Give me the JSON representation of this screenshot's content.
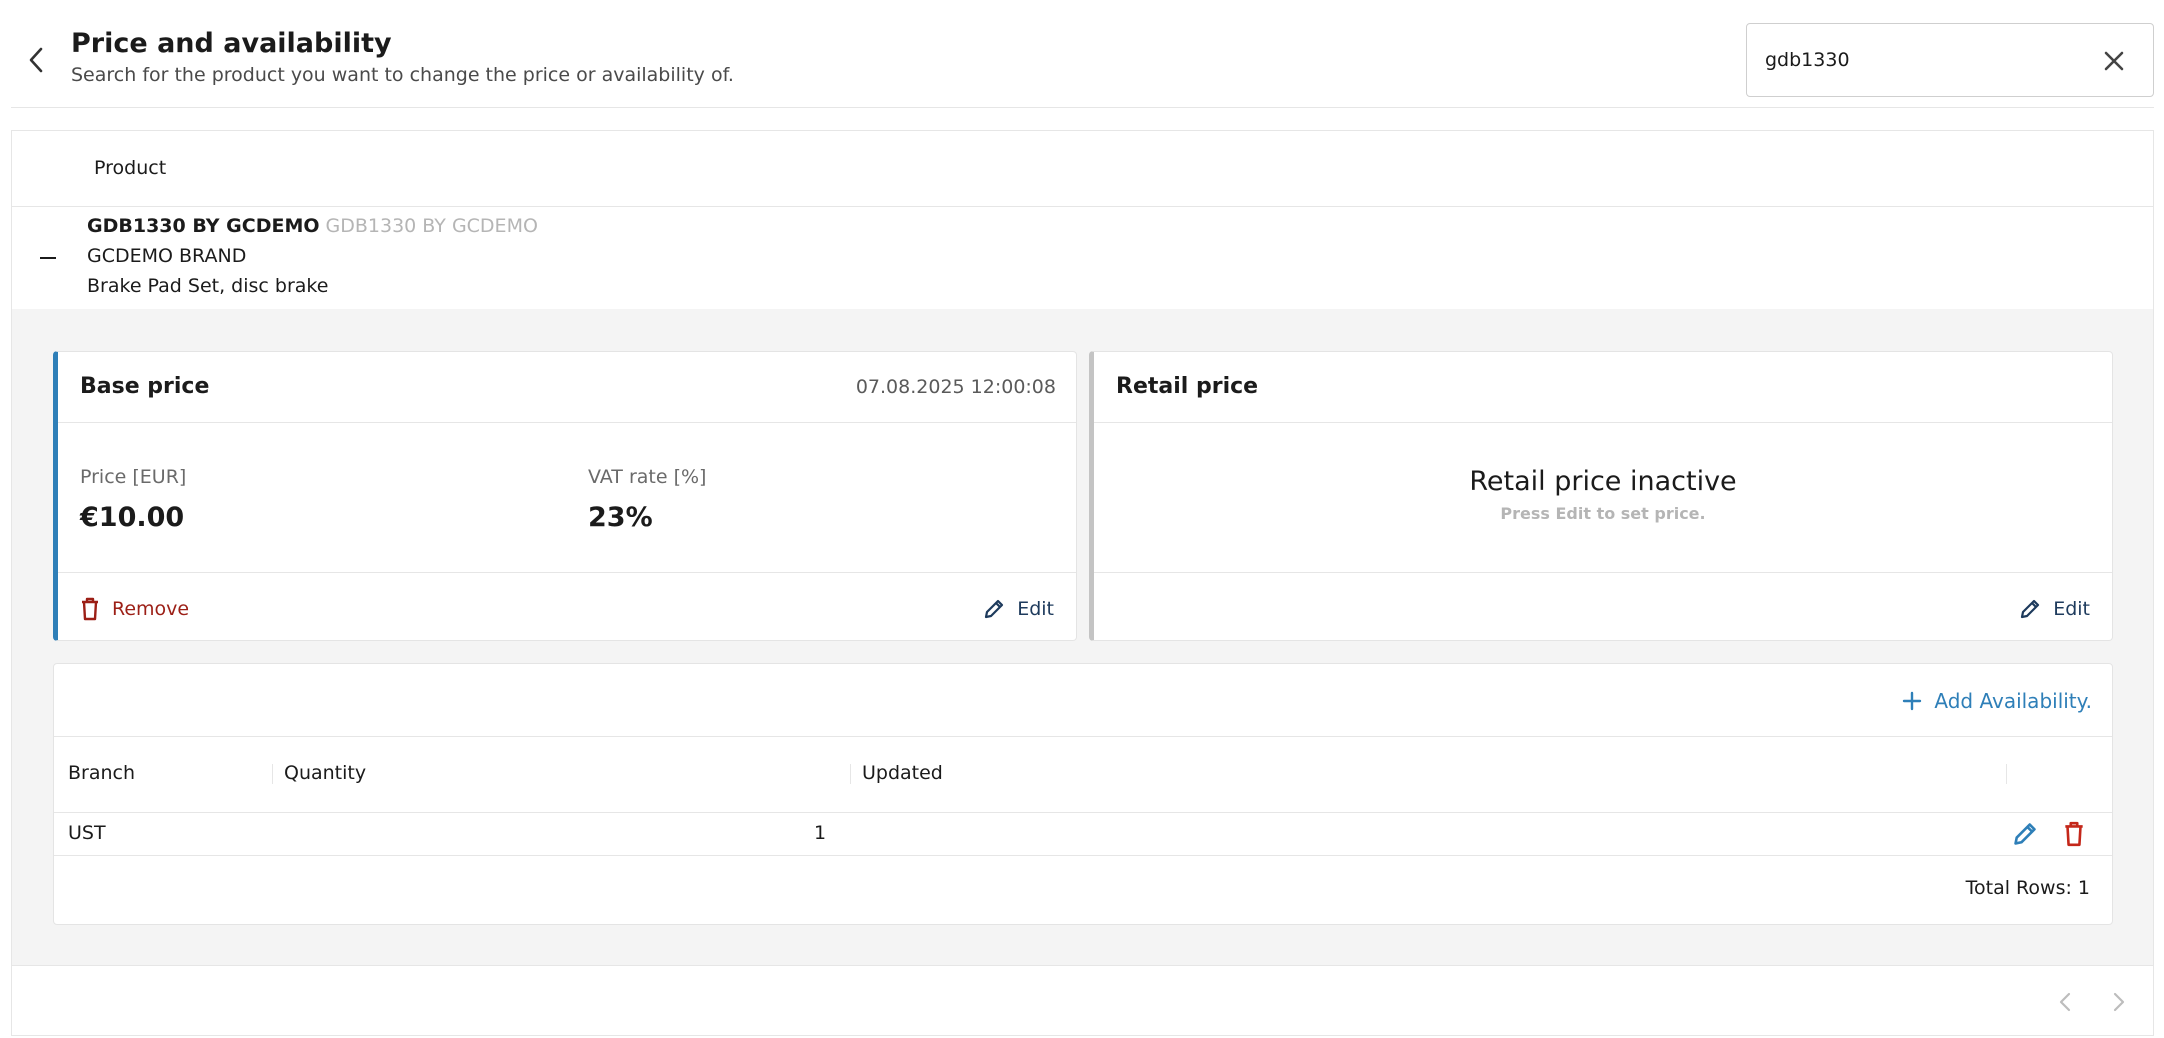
{
  "header": {
    "title": "Price and availability",
    "subtitle": "Search for the product you want to change the price or availability of.",
    "back_icon": "chevron-left-icon",
    "search": {
      "value": "gdb1330",
      "clear_icon": "close-icon"
    }
  },
  "table": {
    "column_product": "Product"
  },
  "product": {
    "code": "GDB1330 BY GCDEMO",
    "code_secondary": "GDB1330 BY GCDEMO",
    "brand": "GCDEMO BRAND",
    "description": "Brake Pad Set, disc brake",
    "expanded": true
  },
  "base_price": {
    "title": "Base price",
    "date": "07.08.2025 12:00:08",
    "price_label": "Price [EUR]",
    "price_value": "€10.00",
    "vat_label": "VAT rate [%]",
    "vat_value": "23%",
    "remove_label": "Remove",
    "edit_label": "Edit",
    "accent_color": "#2e7fb8"
  },
  "retail_price": {
    "title": "Retail price",
    "status": "Retail price inactive",
    "hint": "Press Edit to set price.",
    "edit_label": "Edit"
  },
  "availability": {
    "add_label": "Add Availability.",
    "columns": [
      "Branch",
      "Quantity",
      "Updated"
    ],
    "rows": [
      {
        "branch": "UST",
        "quantity": "1",
        "updated": ""
      }
    ],
    "total_rows": "Total Rows: 1"
  },
  "colors": {
    "primary": "#2e7fb8",
    "danger": "#9c1f16",
    "link_dark": "#1d3a5c",
    "background_muted": "#f4f4f4"
  }
}
